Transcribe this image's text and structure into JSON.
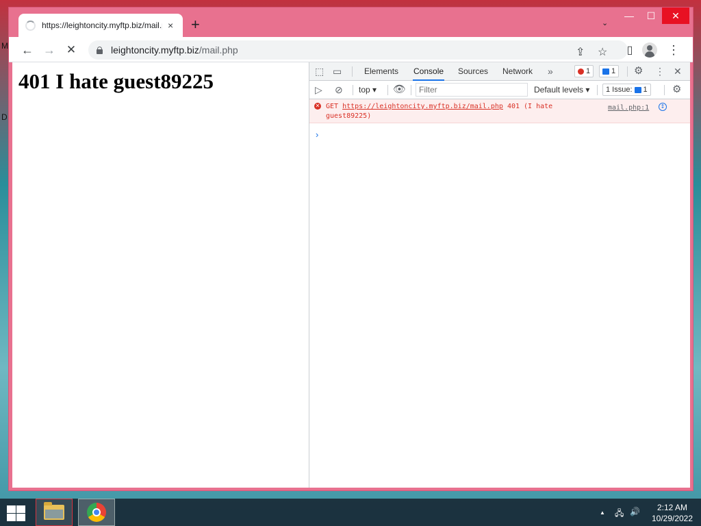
{
  "desktop": {
    "glyph_top": "M",
    "glyph_mid": "D"
  },
  "browser": {
    "tab_title": "https://leightoncity.myftp.biz/mail.php",
    "tab_close": "×",
    "new_tab": "+",
    "tab_search": "⌄",
    "window_controls": {
      "minimize": "—",
      "maximize": "☐",
      "close": "✕"
    },
    "nav": {
      "back": "←",
      "forward": "→",
      "stop": "✕"
    },
    "url_host": "leightoncity.myftp.biz",
    "url_path": "/mail.php",
    "toolbar_icons": {
      "share": "⇪",
      "bookmark": "☆",
      "side_panel": "▯",
      "menu": "⋮"
    }
  },
  "page": {
    "heading": "401 I hate guest89225"
  },
  "devtools": {
    "tabs": [
      "Elements",
      "Console",
      "Sources",
      "Network"
    ],
    "active_tab": "Console",
    "more_tabs": "»",
    "error_count": "1",
    "message_count": "1",
    "console_toolbar": {
      "context": "top",
      "filter_placeholder": "Filter",
      "levels": "Default levels",
      "issues_label": "1 Issue:",
      "issues_count": "1"
    },
    "error": {
      "method": "GET",
      "url": "https://leightoncity.myftp.biz/mail.php",
      "status": "401 (I hate",
      "status_cont": "guest89225)",
      "source": "mail.php:1"
    },
    "prompt": "›"
  },
  "taskbar": {
    "time": "2:12 AM",
    "date": "10/29/2022",
    "tray": {
      "chevron": "▲",
      "network": "🖧",
      "volume": "🔊"
    }
  }
}
